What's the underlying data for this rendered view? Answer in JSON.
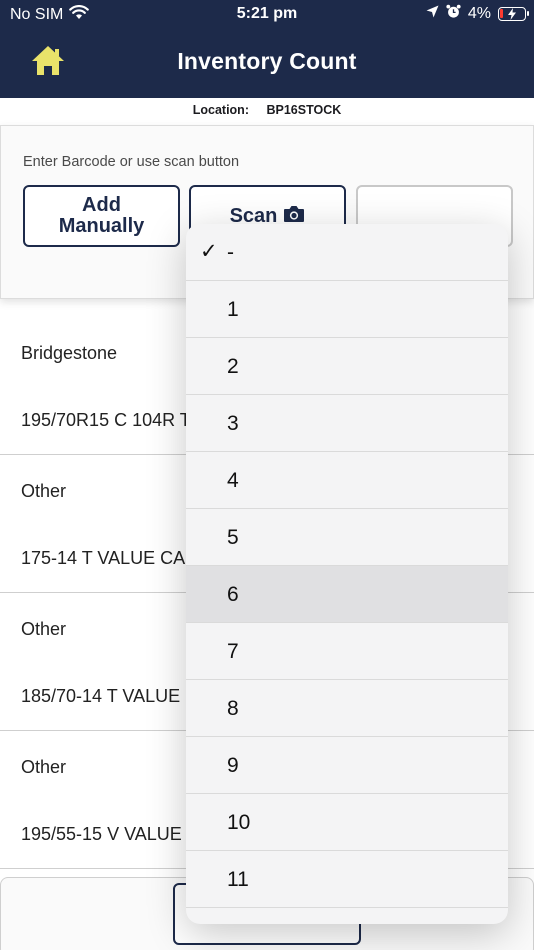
{
  "status": {
    "carrier": "No SIM",
    "time": "5:21 pm",
    "battery": "4%"
  },
  "header": {
    "title": "Inventory Count"
  },
  "location": {
    "label": "Location:",
    "value": "BP16STOCK"
  },
  "entry": {
    "hint": "Enter Barcode or use scan button",
    "add_label": "Add Manually",
    "scan_label": "Scan"
  },
  "items": [
    {
      "brand": "Bridgestone",
      "size": "195/70R15 C 104R T"
    },
    {
      "brand": "Other",
      "size": "175-14  T VALUE CA"
    },
    {
      "brand": "Other",
      "size": "185/70-14  T VALUE"
    },
    {
      "brand": "Other",
      "size": "195/55-15  V VALUE"
    }
  ],
  "picker": {
    "options": [
      "-",
      "1",
      "2",
      "3",
      "4",
      "5",
      "6",
      "7",
      "8",
      "9",
      "10",
      "11"
    ],
    "selected": "-",
    "highlighted": "6"
  },
  "colors": {
    "header_bg": "#1d2a4a",
    "home_icon": "#e9e26a",
    "battery_low": "#ff3b30"
  }
}
